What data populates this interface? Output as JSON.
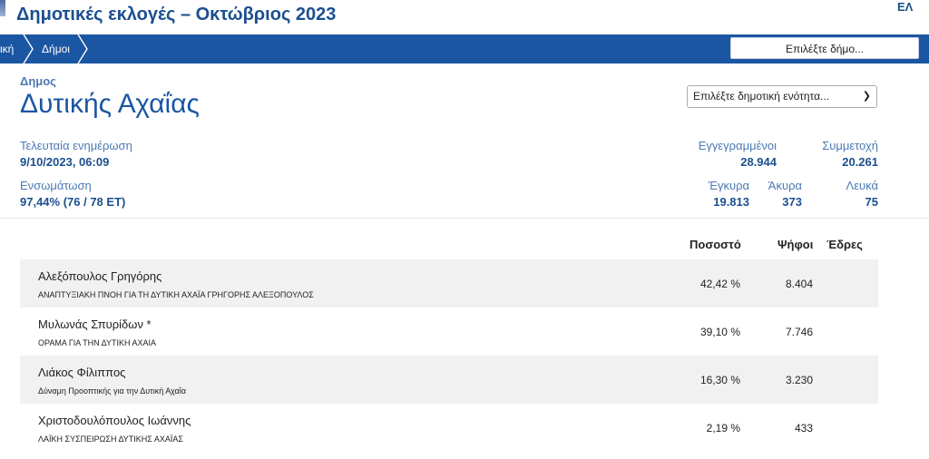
{
  "header": {
    "title": "Δημοτικές εκλογές – Οκτώβριος 2023",
    "lang": "ΕΛ"
  },
  "nav": {
    "crumb_prev": "ική",
    "crumb_current": "Δήμοι",
    "select_municipality": "Επιλέξτε δήμο..."
  },
  "municipality": {
    "label": "Δημος",
    "name": "Δυτικής Αχαΐας",
    "unit_select": "Επιλέξτε δημοτική ενότητα..."
  },
  "stats": {
    "last_update_label": "Τελευταία ενημέρωση",
    "last_update_value": "9/10/2023, 06:09",
    "incorporation_label": "Ενσωμάτωση",
    "incorporation_value": "97,44% (76 / 78 ΕΤ)",
    "registered_label": "Εγγεγραμμένοι",
    "registered_value": "28.944",
    "turnout_label": "Συμμετοχή",
    "turnout_value": "20.261",
    "valid_label": "Έγκυρα",
    "valid_value": "19.813",
    "invalid_label": "Άκυρα",
    "invalid_value": "373",
    "blank_label": "Λευκά",
    "blank_value": "75"
  },
  "table": {
    "headers": {
      "percent": "Ποσοστό",
      "votes": "Ψήφοι",
      "seats": "Έδρες"
    },
    "rows": [
      {
        "candidate": "Αλεξόπουλος Γρηγόρης",
        "party": "ΑΝΑΠΤΥΞΙΑΚΗ ΠΝΟΗ ΓΙΑ ΤΗ ΔΥΤΙΚΗ ΑΧΑΪΑ ΓΡΗΓΟΡΗΣ ΑΛΕΞΟΠΟΥΛΟΣ",
        "percent": "42,42 %",
        "votes": "8.404"
      },
      {
        "candidate": "Μυλωνάς Σπυρίδων *",
        "party": "ΟΡΑΜΑ ΓΙΑ ΤΗΝ ΔΥΤΙΚΗ ΑΧΑΙΑ",
        "percent": "39,10 %",
        "votes": "7.746"
      },
      {
        "candidate": "Λιάκος Φίλιππος",
        "party": "Δύναμη Προοπτικής για την Δυτική Αχαΐα",
        "percent": "16,30 %",
        "votes": "3.230"
      },
      {
        "candidate": "Χριστοδουλόπουλος Ιωάννης",
        "party": "ΛΑΪΚΗ ΣΥΣΠΕΙΡΩΣΗ ΔΥΤΙΚΗΣ ΑΧΑΪΑΣ",
        "percent": "2,19 %",
        "votes": "433"
      }
    ]
  }
}
